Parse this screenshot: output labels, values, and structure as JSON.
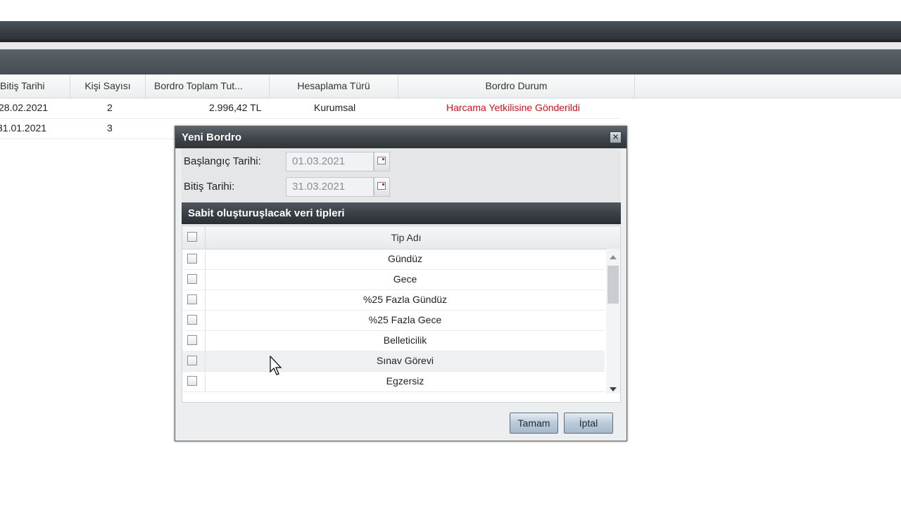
{
  "table": {
    "headers": [
      "Bitiş Tarihi",
      "Kişi Sayısı",
      "Bordro Toplam Tut...",
      "Hesaplama Türü",
      "Bordro Durum"
    ],
    "rows": [
      {
        "bitis": "28.02.2021",
        "kisi": "2",
        "tutar": "2.996,42 TL",
        "tur": "Kurumsal",
        "durum": "Harcama Yetkilisine Gönderildi"
      },
      {
        "bitis": "31.01.2021",
        "kisi": "3",
        "tutar": "",
        "tur": "",
        "durum": ""
      }
    ],
    "status_color": "#d0121b"
  },
  "dialog": {
    "title": "Yeni Bordro",
    "close_icon": "close-icon",
    "start_label": "Başlangıç Tarihi:",
    "start_value": "01.03.2021",
    "end_label": "Bitiş Tarihi:",
    "end_value": "31.03.2021",
    "section_title": "Sabit oluşturuşlacak veri tipleri",
    "list_header": "Tip Adı",
    "items": [
      "Gündüz",
      "Gece",
      "%25 Fazla Gündüz",
      "%25 Fazla Gece",
      "Belleticilik",
      "Sınav Görevi",
      "Egzersiz"
    ],
    "ok_label": "Tamam",
    "cancel_label": "İptal"
  }
}
